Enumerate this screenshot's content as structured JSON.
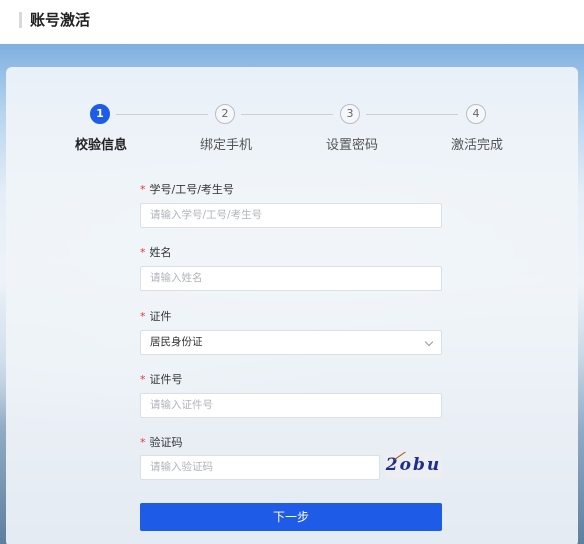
{
  "page": {
    "title": "账号激活"
  },
  "steps": [
    {
      "number": "1",
      "label": "校验信息",
      "active": true
    },
    {
      "number": "2",
      "label": "绑定手机",
      "active": false
    },
    {
      "number": "3",
      "label": "设置密码",
      "active": false
    },
    {
      "number": "4",
      "label": "激活完成",
      "active": false
    }
  ],
  "form": {
    "required_mark": "*",
    "student_id": {
      "label": "学号/工号/考生号",
      "placeholder": "请输入学号/工号/考生号"
    },
    "name": {
      "label": "姓名",
      "placeholder": "请输入姓名"
    },
    "document_type": {
      "label": "证件",
      "value": "居民身份证"
    },
    "document_number": {
      "label": "证件号",
      "placeholder": "请输入证件号"
    },
    "captcha": {
      "label": "验证码",
      "placeholder": "请输入验证码",
      "image_text": "2obu"
    },
    "next_button": "下一步"
  },
  "colors": {
    "primary": "#1e5be6",
    "required": "#e53935"
  }
}
